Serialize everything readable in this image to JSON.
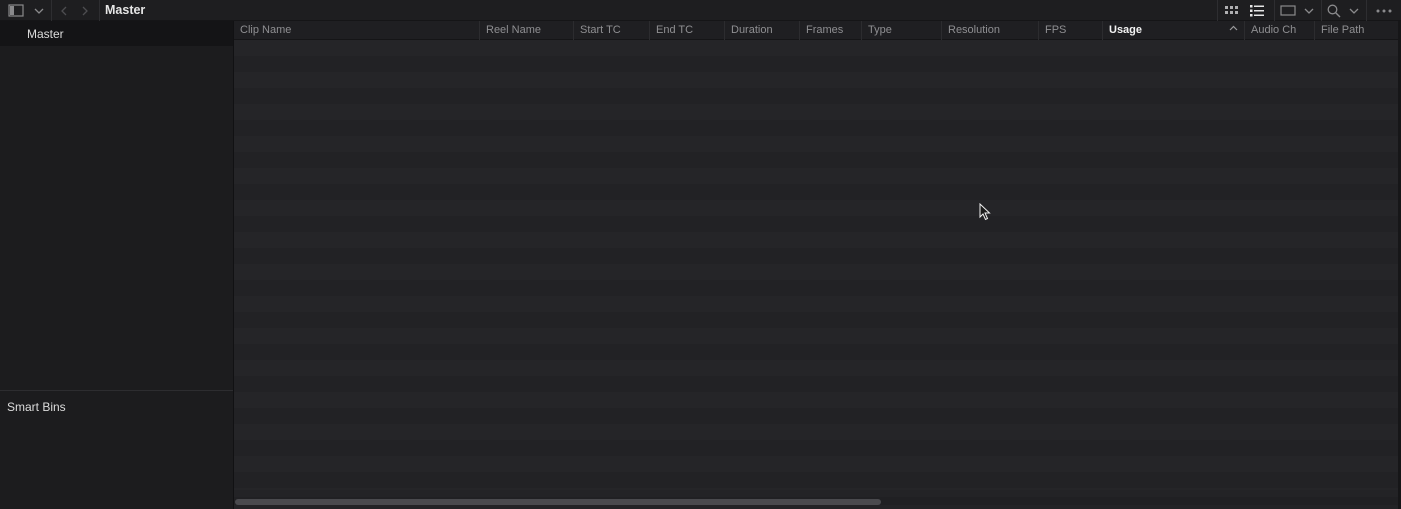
{
  "toolbar": {
    "title": "Master",
    "left_icons": [
      "panel-toggle-icon",
      "chevron-down-icon",
      "back-arrow-icon",
      "forward-arrow-icon"
    ],
    "right_icons": [
      "thumbnail-view-icon",
      "list-view-icon",
      "clip-view-icon",
      "chevron-down-icon",
      "search-icon",
      "chevron-down-icon",
      "more-options-icon"
    ]
  },
  "sidebar": {
    "master_bin": "Master",
    "smart_bins_label": "Smart Bins"
  },
  "table": {
    "columns": [
      {
        "label": "Clip Name"
      },
      {
        "label": "Reel Name"
      },
      {
        "label": "Start TC"
      },
      {
        "label": "End TC"
      },
      {
        "label": "Duration"
      },
      {
        "label": "Frames"
      },
      {
        "label": "Type"
      },
      {
        "label": "Resolution"
      },
      {
        "label": "FPS"
      },
      {
        "label": "Usage",
        "sorted": "ascending"
      },
      {
        "label": "Audio Ch"
      },
      {
        "label": "File Path"
      }
    ],
    "rows": []
  },
  "colors": {
    "background": "#1c1c1e",
    "list_background": "#232326",
    "active_header": "#f2f2f2",
    "header_text": "#8f8f92"
  }
}
